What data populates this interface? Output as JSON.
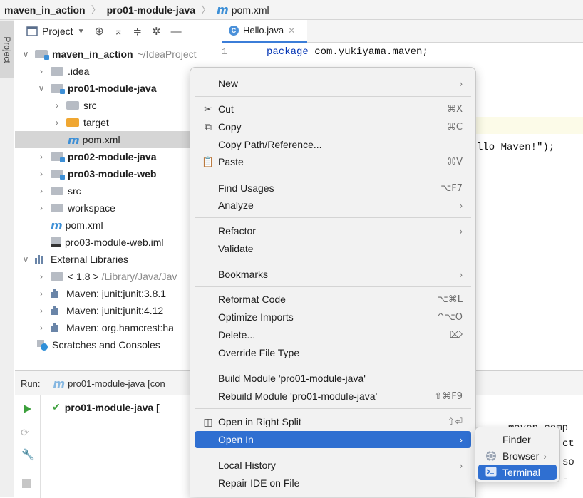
{
  "breadcrumb": {
    "items": [
      "maven_in_action",
      "pro01-module-java",
      "pom.xml"
    ]
  },
  "toolstrip": {
    "project_tab": "Project"
  },
  "project_toolbar": {
    "label": "Project"
  },
  "editor": {
    "tab": "Hello.java",
    "line_number": "1",
    "line1_keyword": "package",
    "line1_rest": " com.yukiyama.maven;",
    "fragment": "llo Maven!\");"
  },
  "tree": {
    "root_name": "maven_in_action",
    "root_path": "~/IdeaProject",
    "idea": ".idea",
    "module1": "pro01-module-java",
    "src": "src",
    "target": "target",
    "pom": "pom.xml",
    "module2": "pro02-module-java",
    "module3": "pro03-module-web",
    "src2": "src",
    "workspace": "workspace",
    "pom2": "pom.xml",
    "iml": "pro03-module-web.iml",
    "ext_libs": "External Libraries",
    "jdk": "< 1.8 >",
    "jdk_path": "/Library/Java/Jav",
    "lib1": "Maven: junit:junit:3.8.1",
    "lib2": "Maven: junit:junit:4.12",
    "lib3": "Maven: org.hamcrest:ha",
    "scratches": "Scratches and Consoles"
  },
  "run": {
    "label": "Run:",
    "config": "pro01-module-java [con",
    "tree_item": "pro01-module-java [",
    "console": [
      "maven_comp",
      "ct",
      "so",
      "-"
    ]
  },
  "context_menu": {
    "new": "New",
    "cut": "Cut",
    "cut_sc": "⌘X",
    "copy": "Copy",
    "copy_sc": "⌘C",
    "copy_path": "Copy Path/Reference...",
    "paste": "Paste",
    "paste_sc": "⌘V",
    "find_usages": "Find Usages",
    "find_usages_sc": "⌥F7",
    "analyze": "Analyze",
    "refactor": "Refactor",
    "validate": "Validate",
    "bookmarks": "Bookmarks",
    "reformat": "Reformat Code",
    "reformat_sc": "⌥⌘L",
    "optimize": "Optimize Imports",
    "optimize_sc": "^⌥O",
    "delete": "Delete...",
    "delete_sc": "⌦",
    "override": "Override File Type",
    "build": "Build Module 'pro01-module-java'",
    "rebuild": "Rebuild Module 'pro01-module-java'",
    "rebuild_sc": "⇧⌘F9",
    "open_split": "Open in Right Split",
    "open_split_sc": "⇧⏎",
    "open_in": "Open In",
    "local_history": "Local History",
    "repair": "Repair IDE on File"
  },
  "submenu": {
    "finder": "Finder",
    "browser": "Browser",
    "terminal": "Terminal"
  },
  "colors": {
    "accent": "#2f6fd1",
    "folder_orange": "#f0a732",
    "folder_grey": "#b7bcc4",
    "run_green": "#3ca03c"
  }
}
